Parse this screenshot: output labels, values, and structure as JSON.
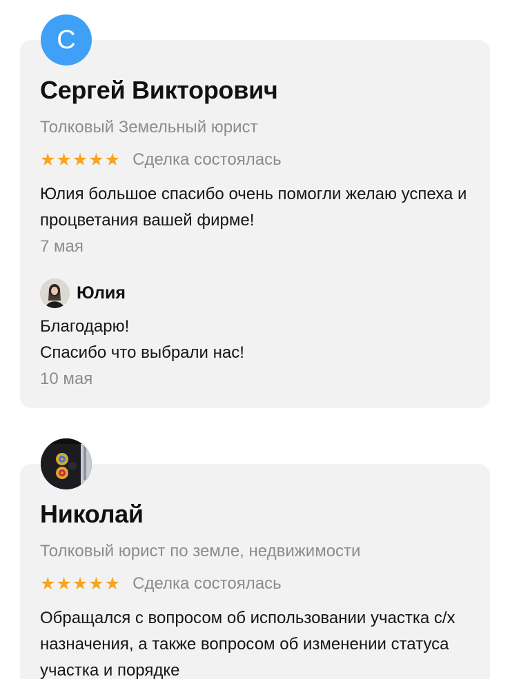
{
  "reviews": [
    {
      "avatar_letter": "С",
      "avatar_color": "#3ea0f6",
      "author": "Сергей Викторович",
      "title": "Толковый Земельный юрист",
      "rating": 5,
      "stars": [
        "★",
        "★",
        "★",
        "★",
        "★"
      ],
      "deal_status": "Сделка состоялась",
      "text": "Юлия большое спасибо очень помогли желаю успеха и процветания вашей фирме!",
      "date": "7 мая",
      "reply": {
        "author": "Юлия",
        "text_line1": "Благодарю!",
        "text_line2": "Спасибо что выбрали нас!",
        "date": "10 мая"
      }
    },
    {
      "author": "Николай",
      "title": "Толковый юрист по земле, недвижимости",
      "rating": 5,
      "stars": [
        "★",
        "★",
        "★",
        "★",
        "★"
      ],
      "deal_status": "Сделка состоялась",
      "text": "Обращался с вопросом об использовании участка с/х назначения, а также вопросом об изменении статуса участка и порядке"
    }
  ],
  "colors": {
    "card_background": "#f2f2f2",
    "star": "#f9a51a",
    "muted_text": "#8c8c8c"
  }
}
